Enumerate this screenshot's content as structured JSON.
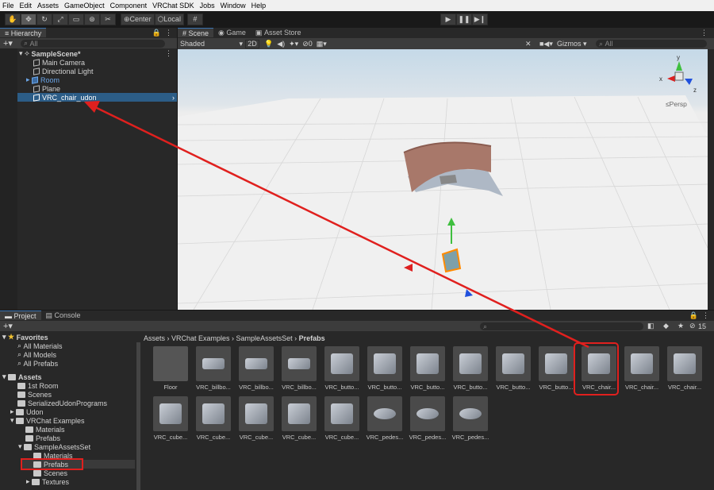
{
  "menu": [
    "File",
    "Edit",
    "Assets",
    "GameObject",
    "Component",
    "VRChat SDK",
    "Jobs",
    "Window",
    "Help"
  ],
  "toolbar": {
    "center_label": "Center",
    "local_label": "Local"
  },
  "hierarchy": {
    "tab": "Hierarchy",
    "search_placeholder": "All",
    "scene": "SampleScene*",
    "items": [
      "Main Camera",
      "Directional Light",
      "Room",
      "Plane",
      "VRC_chair_udon"
    ]
  },
  "scene_view": {
    "tabs": [
      "Scene",
      "Game",
      "Asset Store"
    ],
    "shading": "Shaded",
    "mode_2d": "2D",
    "hidden_count": "0",
    "gizmos": "Gizmos",
    "search_placeholder": "All",
    "persp": "Persp",
    "axis_y": "y",
    "axis_x": "x",
    "axis_z": "z"
  },
  "project": {
    "tabs": [
      "Project",
      "Console"
    ],
    "hidden_count": "15",
    "favorites_label": "Favorites",
    "favorites": [
      "All Materials",
      "All Models",
      "All Prefabs"
    ],
    "assets_label": "Assets",
    "tree": [
      "1st Room",
      "Scenes",
      "SerializedUdonPrograms",
      "Udon",
      "VRChat Examples",
      "Materials",
      "Prefabs",
      "SampleAssetsSet",
      "Materials",
      "Prefabs",
      "Scenes",
      "Textures"
    ],
    "breadcrumb": [
      "Assets",
      "VRChat Examples",
      "SampleAssetsSet",
      "Prefabs"
    ],
    "grid_row1": [
      "Floor",
      "VRC_billbo...",
      "VRC_billbo...",
      "VRC_billbo...",
      "VRC_butto...",
      "VRC_butto...",
      "VRC_butto...",
      "VRC_butto...",
      "VRC_butto...",
      "VRC_butto...",
      "VRC_chair...",
      "VRC_chair...",
      "VRC_chair..."
    ],
    "grid_row2": [
      "VRC_cube...",
      "VRC_cube...",
      "VRC_cube...",
      "VRC_cube...",
      "VRC_cube...",
      "VRC_pedes...",
      "VRC_pedes...",
      "VRC_pedes..."
    ]
  },
  "colors": {
    "selection": "#2c5d87",
    "annotation": "#e0201e",
    "accent": "#3a72b0"
  }
}
